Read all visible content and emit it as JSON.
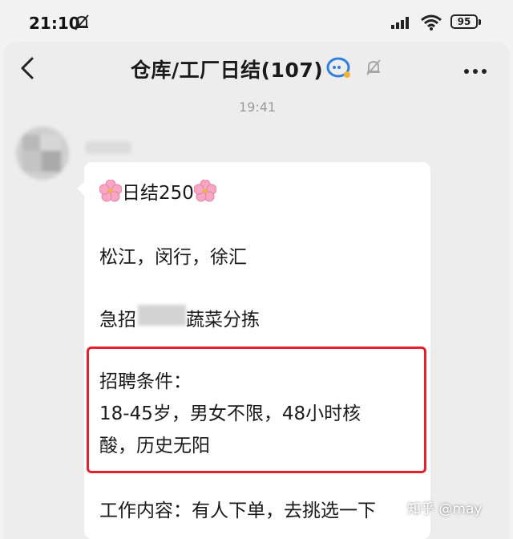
{
  "status_bar": {
    "time": "21:10",
    "battery": "95",
    "icons": [
      "mute-icon",
      "signal-icon",
      "wifi-icon",
      "battery-icon"
    ]
  },
  "header": {
    "title": "仓库/工厂日结(107)",
    "icons": [
      "back-icon",
      "group-icon",
      "bell-off-icon",
      "more-icon"
    ]
  },
  "timestamp": "19:41",
  "message": {
    "line1_text": "日结250",
    "line2": "松江，闵行，徐汇",
    "line3_prefix": "急招",
    "line3_suffix": "蔬菜分拣",
    "conditions_label": "招聘条件：",
    "conditions_line1": "18-45岁，男女不限，48小时核",
    "conditions_line2": "酸，历史无阳",
    "work_content": "工作内容：有人下单，去挑选一下"
  },
  "watermark": "知乎 @may",
  "colors": {
    "highlight_border": "#e5212b",
    "bubble": "#ffffff",
    "background": "#ededed",
    "flower": "#f7a6c4"
  }
}
